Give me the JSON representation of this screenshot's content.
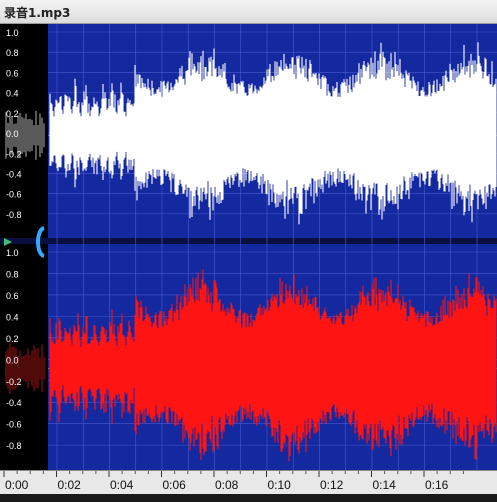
{
  "window": {
    "title": "录音1.mp3"
  },
  "waveform": {
    "colors": {
      "background": "#1428a0",
      "upper_wave": "#ffffff",
      "lower_wave": "#ff1414",
      "gutter": "#000000",
      "grid": "#4a5ad0",
      "label": "#ffffff"
    },
    "amplitude_labels": [
      "1.0",
      "0.8",
      "0.6",
      "0.4",
      "0.2",
      "0.0",
      "-0.2",
      "-0.4",
      "-0.6",
      "-0.8"
    ],
    "channels": [
      {
        "name": "upper-channel",
        "color": "#ffffff"
      },
      {
        "name": "lower-channel",
        "color": "#ff1414"
      }
    ]
  },
  "timeline": {
    "labels": [
      "0:00",
      "0:02",
      "0:04",
      "0:06",
      "0:08",
      "0:10",
      "0:12",
      "0:14",
      "0:16"
    ]
  },
  "icons": {
    "marker": "play-marker-icon",
    "handle": "selection-handle-icon"
  }
}
